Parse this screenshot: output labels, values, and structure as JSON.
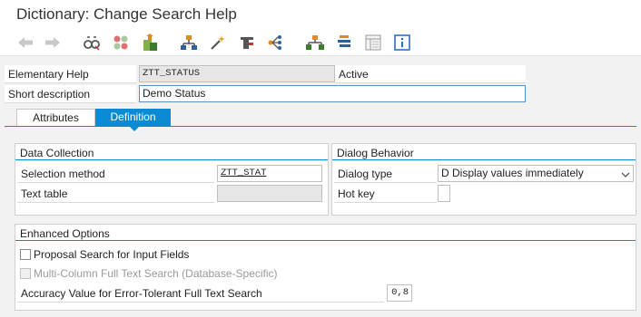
{
  "window": {
    "title": "Dictionary: Change Search Help"
  },
  "toolbar": {
    "icons": [
      "back-icon",
      "forward-icon",
      "glasses-icon",
      "other-object-icon",
      "activate-icon",
      "check-icon",
      "where-used-icon",
      "magic-wand-icon",
      "test-icon",
      "object-list-icon",
      "navigate-icon",
      "hierarchy-icon",
      "display-object-list-icon",
      "layout-icon",
      "info-icon"
    ]
  },
  "header": {
    "elementary_help_label": "Elementary Help",
    "elementary_help_value": "ZTT_STATUS",
    "status": "Active",
    "short_description_label": "Short description",
    "short_description_value": "Demo Status"
  },
  "tabs": [
    {
      "label": "Attributes",
      "active": false
    },
    {
      "label": "Definition",
      "active": true
    }
  ],
  "data_collection": {
    "title": "Data Collection",
    "selection_method_label": "Selection method",
    "selection_method_value": "ZTT_STAT",
    "text_table_label": "Text table",
    "text_table_value": ""
  },
  "dialog_behavior": {
    "title": "Dialog Behavior",
    "dialog_type_label": "Dialog type",
    "dialog_type_value": "D Display values immediately",
    "hot_key_label": "Hot key",
    "hot_key_value": ""
  },
  "enhanced_options": {
    "title": "Enhanced Options",
    "proposal_search_label": "Proposal Search for Input Fields",
    "proposal_search_checked": false,
    "multi_column_label": "Multi-Column Full Text Search (Database-Specific)",
    "multi_column_checked": false,
    "accuracy_label": "Accuracy Value for Error-Tolerant Full Text Search",
    "accuracy_value": "0,8"
  },
  "colors": {
    "accent": "#0a8bd3",
    "background": "#f2f2f2"
  }
}
